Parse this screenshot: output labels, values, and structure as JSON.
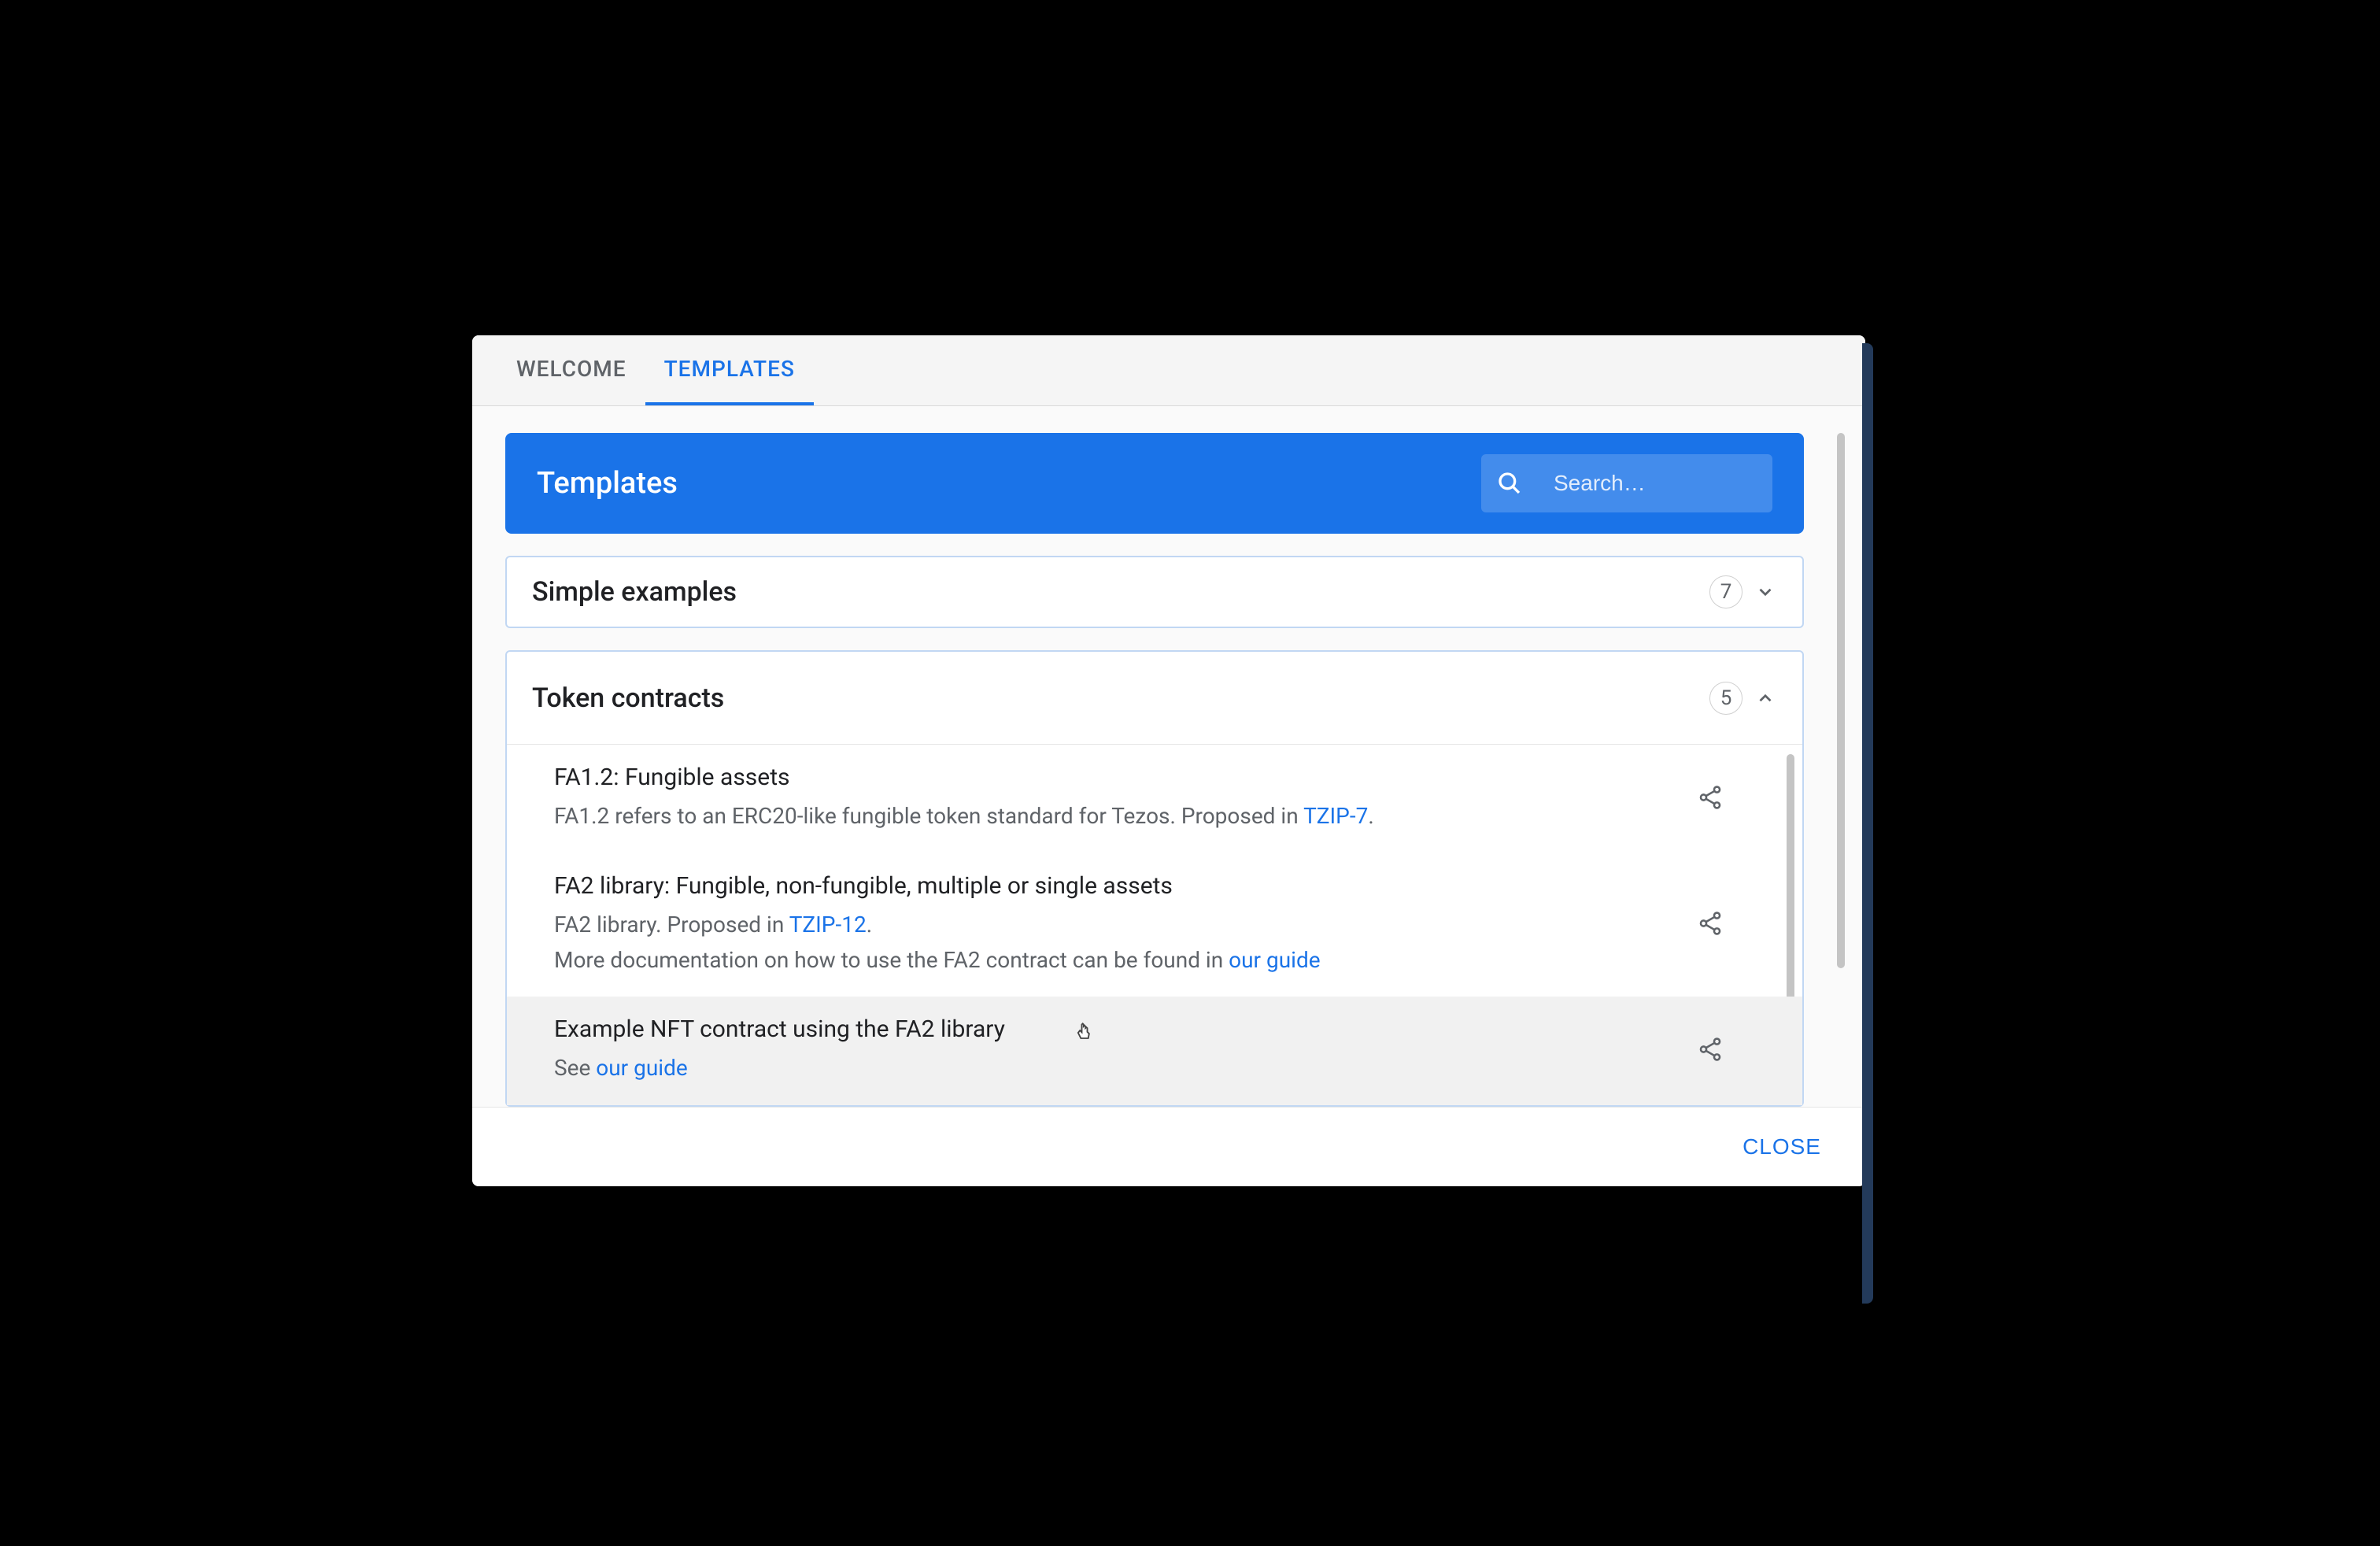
{
  "tabs": {
    "welcome": "WELCOME",
    "templates": "TEMPLATES"
  },
  "header": {
    "title": "Templates",
    "search_placeholder": "Search…"
  },
  "sections": {
    "simple": {
      "title": "Simple examples",
      "count": "7"
    },
    "token": {
      "title": "Token contracts",
      "count": "5",
      "items": [
        {
          "title": "FA1.2: Fungible assets",
          "desc_prefix": "FA1.2 refers to an ERC20-like fungible token standard for Tezos. Proposed in ",
          "link1": "TZIP-7",
          "suffix1": "."
        },
        {
          "title": "FA2 library: Fungible, non-fungible, multiple or single assets",
          "desc_prefix": "FA2 library. Proposed in ",
          "link1": "TZIP-12",
          "suffix1": ".",
          "line2_prefix": "More documentation on how to use the FA2 contract can be found in ",
          "link2": "our guide"
        },
        {
          "title": "Example NFT contract using the FA2 library",
          "desc_prefix": "See ",
          "link1": "our guide"
        }
      ]
    }
  },
  "footer": {
    "close": "CLOSE"
  }
}
